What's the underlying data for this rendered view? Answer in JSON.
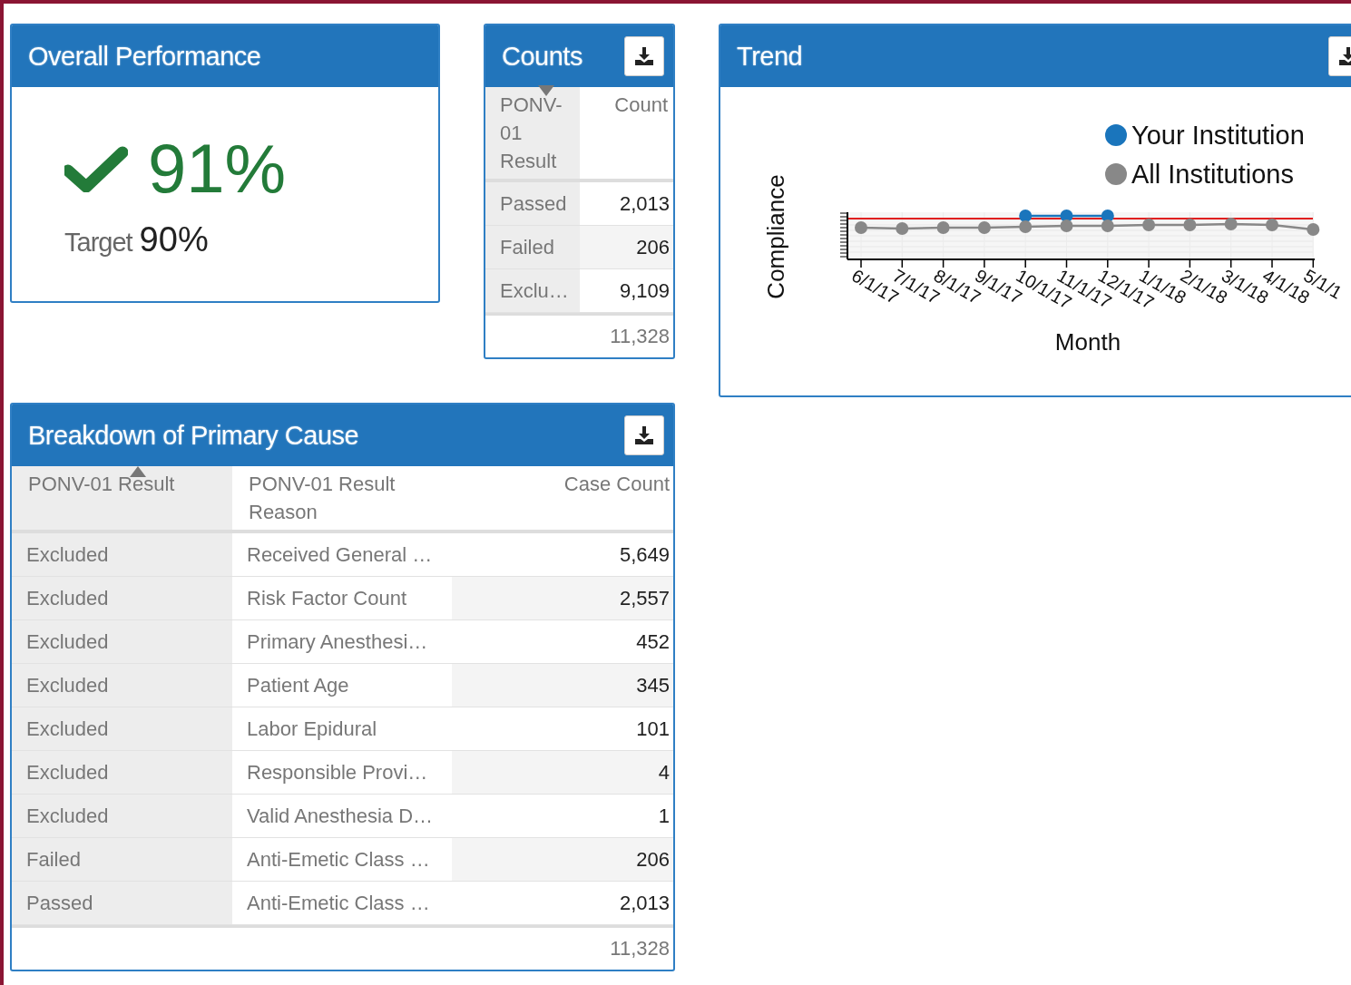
{
  "performance": {
    "title": "Overall Performance",
    "passed": true,
    "value": "91%",
    "target_label": "Target",
    "target_value": "90%"
  },
  "counts": {
    "title": "Counts",
    "sort_ascending": false,
    "columns": [
      {
        "label": "PONV-01 Result",
        "sorted": true
      },
      {
        "label": "Count",
        "sorted": false
      }
    ],
    "rows": [
      {
        "result": "Passed",
        "count": "2,013"
      },
      {
        "result": "Failed",
        "count": "206"
      },
      {
        "result": "Exclu…",
        "count": "9,109"
      }
    ],
    "total": "11,328"
  },
  "trend": {
    "title": "Trend",
    "ylabel": "Compliance",
    "xlabel": "Month",
    "legend": [
      {
        "name": "Your Institution",
        "color": "#1a75bc"
      },
      {
        "name": "All Institutions",
        "color": "#888888"
      }
    ],
    "months": [
      "6/1/17",
      "7/1/17",
      "8/1/17",
      "9/1/17",
      "10/1/17",
      "11/1/17",
      "12/1/17",
      "1/1/18",
      "2/1/18",
      "3/1/18",
      "4/1/18",
      "5/1/1"
    ]
  },
  "breakdown": {
    "title": "Breakdown of Primary Cause",
    "sort_ascending": true,
    "columns": [
      {
        "label": "PONV-01 Result",
        "sorted": true
      },
      {
        "label": "PONV-01 Result Reason",
        "sorted": false
      },
      {
        "label": "Case Count",
        "sorted": false
      }
    ],
    "rows": [
      {
        "result": "Excluded",
        "reason": "Received General …",
        "count": "5,649"
      },
      {
        "result": "Excluded",
        "reason": "Risk Factor Count",
        "count": "2,557"
      },
      {
        "result": "Excluded",
        "reason": "Primary Anesthesi…",
        "count": "452"
      },
      {
        "result": "Excluded",
        "reason": "Patient Age",
        "count": "345"
      },
      {
        "result": "Excluded",
        "reason": "Labor Epidural",
        "count": "101"
      },
      {
        "result": "Excluded",
        "reason": "Responsible Provi…",
        "count": "4"
      },
      {
        "result": "Excluded",
        "reason": "Valid Anesthesia D…",
        "count": "1"
      },
      {
        "result": "Failed",
        "reason": "Anti-Emetic Class …",
        "count": "206"
      },
      {
        "result": "Passed",
        "reason": "Anti-Emetic Class …",
        "count": "2,013"
      }
    ],
    "total": "11,328"
  }
}
